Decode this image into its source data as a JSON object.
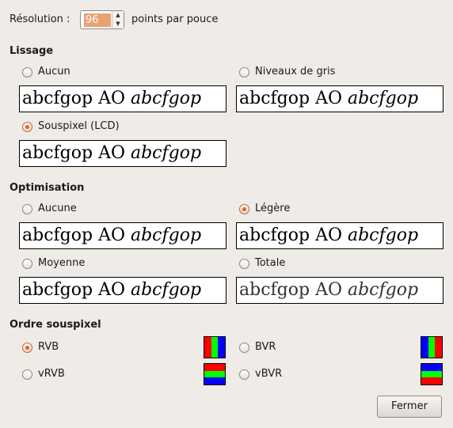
{
  "resolution": {
    "label": "Résolution :",
    "value": "96",
    "unit": "points par pouce"
  },
  "sample": {
    "regular": "abcfgop AO ",
    "italic": "abcfgop"
  },
  "smoothing": {
    "title": "Lissage",
    "options": [
      {
        "label": "Aucun",
        "checked": false
      },
      {
        "label": "Niveaux de gris",
        "checked": false
      },
      {
        "label": "Souspixel (LCD)",
        "checked": true
      }
    ]
  },
  "hinting": {
    "title": "Optimisation",
    "options": [
      {
        "label": "Aucune",
        "checked": false
      },
      {
        "label": "Légère",
        "checked": true
      },
      {
        "label": "Moyenne",
        "checked": false
      },
      {
        "label": "Totale",
        "checked": false
      }
    ]
  },
  "subpixel": {
    "title": "Ordre souspixel",
    "options": [
      {
        "label": "RVB",
        "checked": true,
        "colors": [
          "#ff0000",
          "#00ff00",
          "#0000ff"
        ]
      },
      {
        "label": "BVR",
        "checked": false,
        "colors": [
          "#0000ff",
          "#00ff00",
          "#ff0000"
        ]
      },
      {
        "label": "vRVB",
        "checked": false,
        "colors": [
          "#ff0000",
          "#00ff00",
          "#0000ff"
        ]
      },
      {
        "label": "vBVR",
        "checked": false,
        "colors": [
          "#0000ff",
          "#00ff00",
          "#ff0000"
        ]
      }
    ]
  },
  "close_button": "Fermer"
}
